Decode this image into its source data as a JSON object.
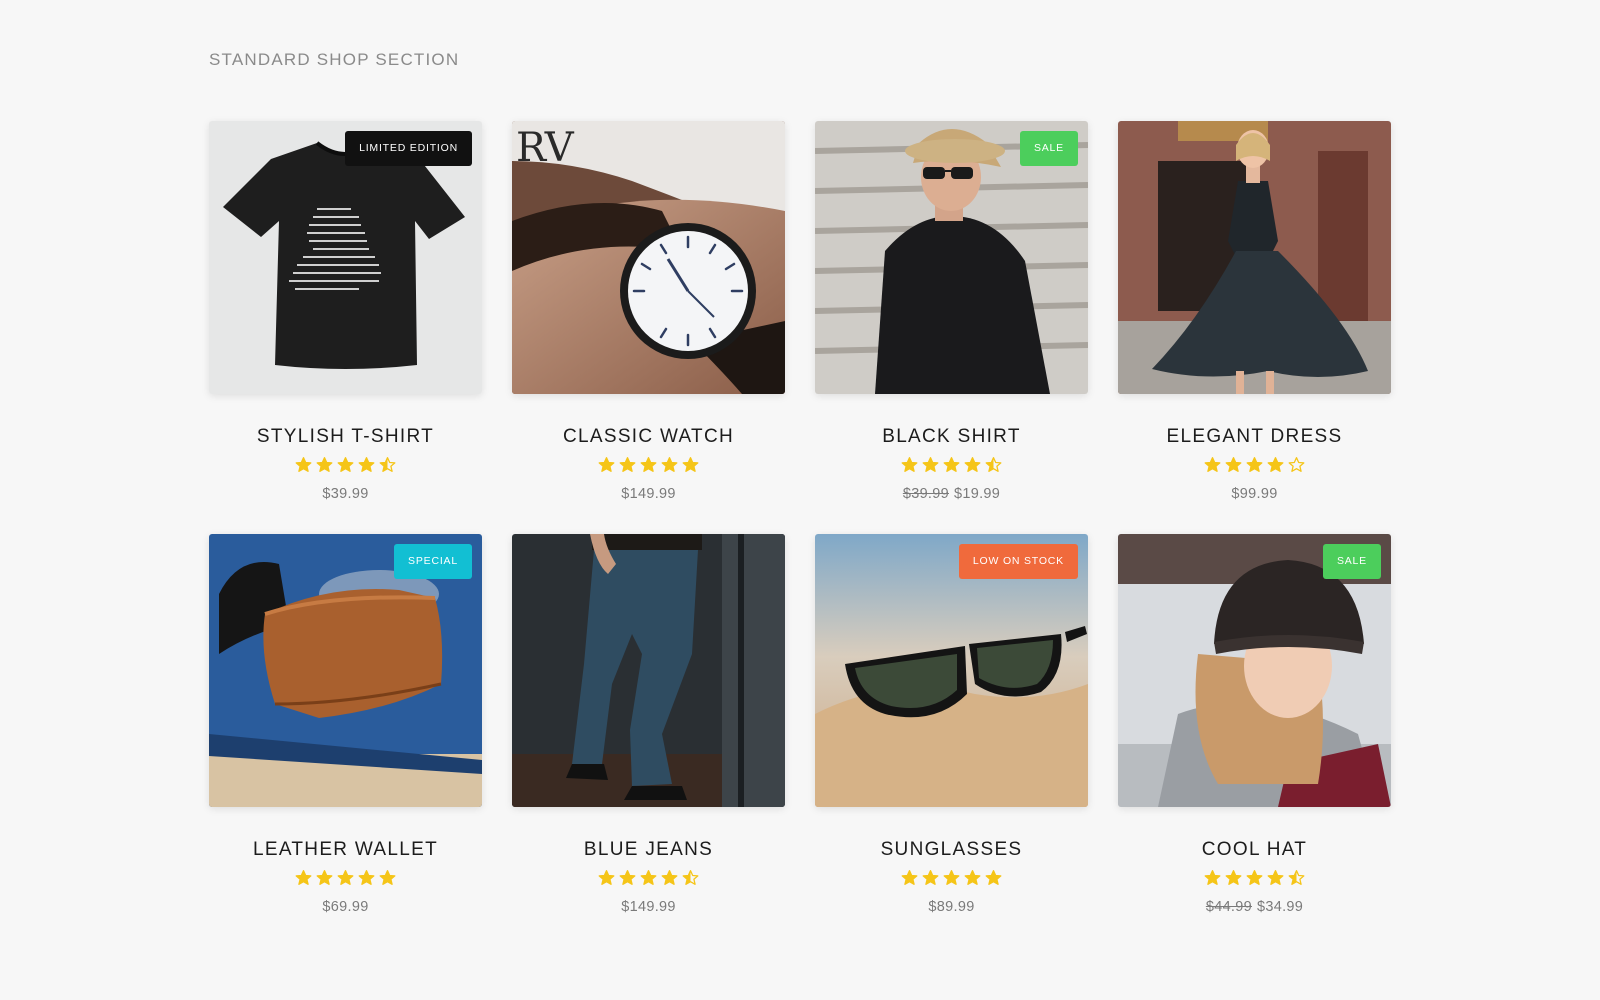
{
  "section_title": "STANDARD SHOP SECTION",
  "colors": {
    "star": "#f5c518",
    "badge_black": "#111111",
    "badge_green": "#4cce5c",
    "badge_cyan": "#12bfd3",
    "badge_orange": "#f06a3c"
  },
  "products": [
    {
      "name": "STYLISH T-SHIRT",
      "rating": 4.5,
      "old_price": "",
      "price": "$39.99",
      "badge": "LIMITED EDITION",
      "badge_color": "#111111",
      "image": "black-tshirt-image"
    },
    {
      "name": "CLASSIC WATCH",
      "rating": 5,
      "old_price": "",
      "price": "$149.99",
      "badge": "",
      "badge_color": "",
      "image": "wrist-watch-image"
    },
    {
      "name": "BLACK SHIRT",
      "rating": 4.5,
      "old_price": "$39.99",
      "price": "$19.99",
      "badge": "SALE",
      "badge_color": "#4cce5c",
      "image": "man-black-shirt-image"
    },
    {
      "name": "ELEGANT DRESS",
      "rating": 4,
      "old_price": "",
      "price": "$99.99",
      "badge": "",
      "badge_color": "",
      "image": "woman-dress-image"
    },
    {
      "name": "LEATHER WALLET",
      "rating": 5,
      "old_price": "",
      "price": "$69.99",
      "badge": "SPECIAL",
      "badge_color": "#12bfd3",
      "image": "leather-wallet-image"
    },
    {
      "name": "BLUE JEANS",
      "rating": 4.5,
      "old_price": "",
      "price": "$149.99",
      "badge": "",
      "badge_color": "",
      "image": "blue-jeans-image"
    },
    {
      "name": "SUNGLASSES",
      "rating": 5,
      "old_price": "",
      "price": "$89.99",
      "badge": "LOW ON STOCK",
      "badge_color": "#f06a3c",
      "image": "sunglasses-image"
    },
    {
      "name": "COOL HAT",
      "rating": 4.5,
      "old_price": "$44.99",
      "price": "$34.99",
      "badge": "SALE",
      "badge_color": "#4cce5c",
      "image": "woman-beanie-image"
    }
  ]
}
